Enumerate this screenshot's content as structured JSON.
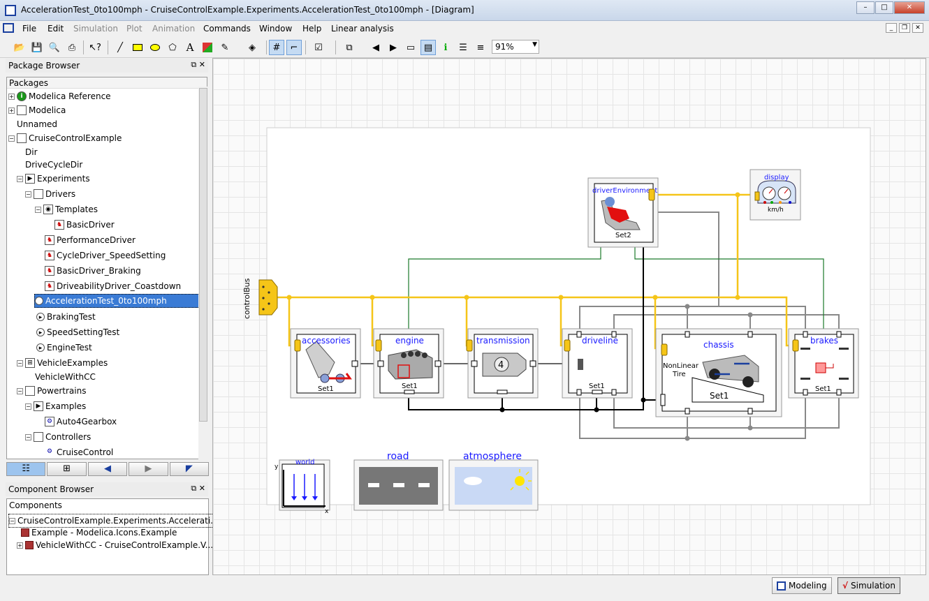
{
  "window": {
    "title": "AccelerationTest_0to100mph - CruiseControlExample.Experiments.AccelerationTest_0to100mph  - [Diagram]"
  },
  "menu": [
    {
      "label": "File",
      "disabled": false
    },
    {
      "label": "Edit",
      "disabled": false
    },
    {
      "label": "Simulation",
      "disabled": true
    },
    {
      "label": "Plot",
      "disabled": true
    },
    {
      "label": "Animation",
      "disabled": true
    },
    {
      "label": "Commands",
      "disabled": false
    },
    {
      "label": "Window",
      "disabled": false
    },
    {
      "label": "Help",
      "disabled": false
    },
    {
      "label": "Linear analysis",
      "disabled": false
    }
  ],
  "toolbar": {
    "zoom": "91%"
  },
  "package_browser": {
    "title": "Package Browser",
    "header": "Packages",
    "items": [
      {
        "label": "Modelica Reference",
        "icon": "info-icon"
      },
      {
        "label": "Modelica",
        "icon": "package-icon"
      },
      {
        "label": "Unnamed",
        "icon": ""
      },
      {
        "label": "CruiseControlExample",
        "icon": "package-icon"
      },
      {
        "label": "Dir",
        "icon": ""
      },
      {
        "label": "DriveCycleDir",
        "icon": ""
      },
      {
        "label": "Experiments",
        "icon": "experiments-icon"
      },
      {
        "label": "Drivers",
        "icon": "package-icon"
      },
      {
        "label": "Templates",
        "icon": "template-icon"
      },
      {
        "label": "BasicDriver",
        "icon": "driver-icon"
      },
      {
        "label": "PerformanceDriver",
        "icon": "driver-icon"
      },
      {
        "label": "CycleDriver_SpeedSetting",
        "icon": "driver-icon"
      },
      {
        "label": "BasicDriver_Braking",
        "icon": "driver-icon"
      },
      {
        "label": "DriveabilityDriver_Coastdown",
        "icon": "driver-icon"
      },
      {
        "label": "AccelerationTest_0to100mph",
        "icon": "test-icon"
      },
      {
        "label": "BrakingTest",
        "icon": "test-icon"
      },
      {
        "label": "SpeedSettingTest",
        "icon": "test-icon"
      },
      {
        "label": "EngineTest",
        "icon": "test-icon"
      },
      {
        "label": "VehicleExamples",
        "icon": "vehicle-icon"
      },
      {
        "label": "VehicleWithCC",
        "icon": ""
      },
      {
        "label": "Powertrains",
        "icon": "package-icon"
      },
      {
        "label": "Examples",
        "icon": "experiments-icon"
      },
      {
        "label": "Auto4Gearbox",
        "icon": "gearbox-icon"
      },
      {
        "label": "Controllers",
        "icon": "package-icon"
      },
      {
        "label": "CruiseControl",
        "icon": "controller-icon"
      }
    ]
  },
  "component_browser": {
    "title": "Component Browser",
    "header": "Components",
    "items": [
      {
        "label": "CruiseControlExample.Experiments.Accelerati..."
      },
      {
        "label": "Example - Modelica.Icons.Example"
      },
      {
        "label": "VehicleWithCC - CruiseControlExample.V..."
      }
    ]
  },
  "diagram": {
    "blocks": {
      "controlBus": "controlBus",
      "driverEnvironment": "driverEnvironment",
      "driverEnvironment_set": "Set2",
      "display": "display",
      "display_unit": "km/h",
      "accessories": "accessories",
      "accessories_set": "Set1",
      "engine": "engine",
      "engine_set": "Set1",
      "transmission": "transmission",
      "transmission_gear": "4",
      "driveline": "driveline",
      "driveline_set": "Set1",
      "chassis": "chassis",
      "chassis_tire": "NonLinear",
      "chassis_tire2": "Tire",
      "chassis_set": "Set1",
      "brakes": "brakes",
      "brakes_set": "Set1",
      "world": "world",
      "world_x": "x",
      "world_y": "y",
      "road": "road",
      "atmosphere": "atmosphere"
    }
  },
  "status_tabs": [
    {
      "label": "Modeling",
      "active": false
    },
    {
      "label": "Simulation",
      "active": true
    }
  ],
  "colors": {
    "bus": "#f5c518",
    "signal": "#1a7a2a",
    "mech": "#000000",
    "frame": "#888888",
    "label": "#1a1aff",
    "selection": "#3a7bd5"
  }
}
